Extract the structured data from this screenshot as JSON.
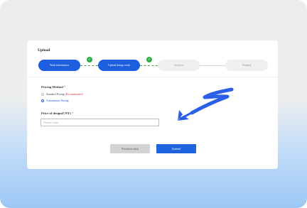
{
  "page": {
    "title": "Upload"
  },
  "steps": [
    {
      "label": "Work information",
      "state": "done"
    },
    {
      "label": "Upload design work",
      "state": "done"
    },
    {
      "label": "Set price",
      "state": "pending"
    },
    {
      "label": "Pending",
      "state": "pending"
    }
  ],
  "step_check_icon": "✓",
  "pricing": {
    "label": "Pricing Method",
    "required_mark": "*",
    "options": [
      {
        "label": "Standard Pricing",
        "note": "(Recommended)",
        "selected": false
      },
      {
        "label": "Autonomous Pricing",
        "note": "",
        "selected": true
      }
    ]
  },
  "price": {
    "label": "Price of design(CNY)",
    "required_mark": "*",
    "value": "",
    "placeholder": "Please enter"
  },
  "buttons": {
    "previous": "Previous step",
    "submit": "Submit"
  },
  "colors": {
    "accent": "#1c5edd",
    "check": "#2fae48",
    "required": "#e03e3e",
    "annotation_arrow": "#2a5fe8"
  },
  "icons": {
    "annotation": "hand-drawn-arrow-icon",
    "step_done": "check-icon"
  }
}
